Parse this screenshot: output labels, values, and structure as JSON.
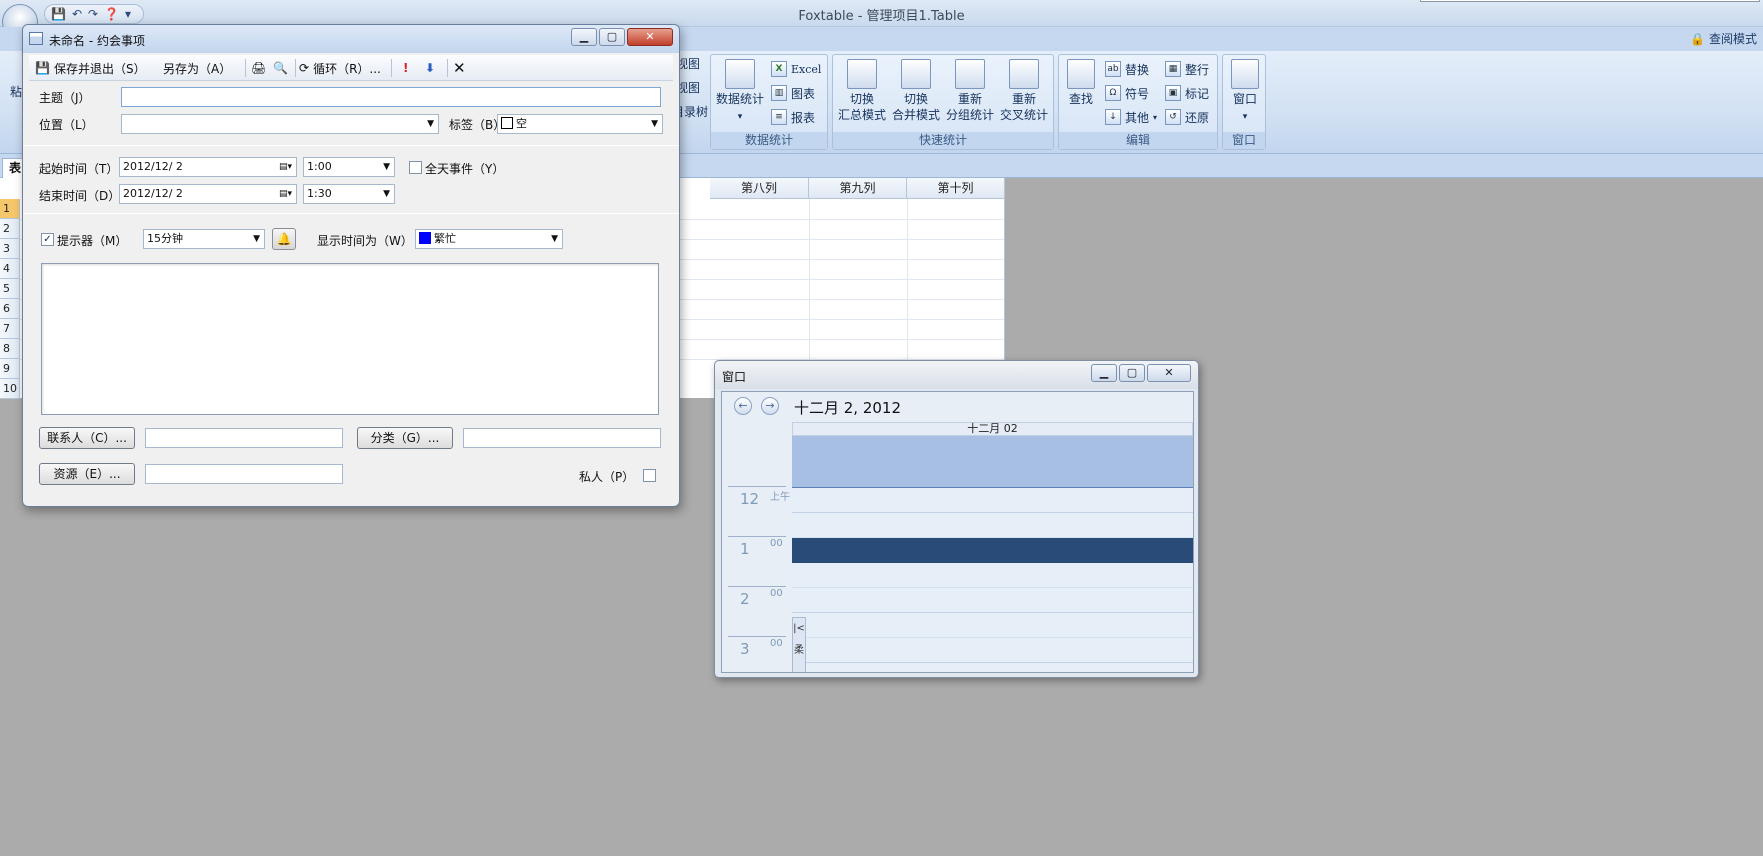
{
  "app": {
    "title": "Foxtable - 管理项目1.Table",
    "review_mode": "查阅模式"
  },
  "ribbon": {
    "clipped_labels": [
      "粘",
      "视图",
      "视图",
      "目录树"
    ],
    "groups": [
      {
        "caption": "数据统计",
        "big": [
          {
            "label": "数据统计",
            "icon": "table-stats-icon"
          }
        ],
        "small": [
          {
            "label": "Excel",
            "icon": "excel-icon"
          },
          {
            "label": "图表",
            "icon": "chart-icon"
          },
          {
            "label": "报表",
            "icon": "report-icon"
          }
        ]
      },
      {
        "caption": "快速统计",
        "big": [
          {
            "label1": "切换",
            "label2": "汇总模式",
            "icon": "summary-mode-icon"
          },
          {
            "label1": "切换",
            "label2": "合并模式",
            "icon": "merge-mode-icon"
          },
          {
            "label1": "重新",
            "label2": "分组统计",
            "icon": "group-stats-icon"
          },
          {
            "label1": "重新",
            "label2": "交叉统计",
            "icon": "cross-stats-icon"
          }
        ]
      },
      {
        "caption": "编辑",
        "big": [
          {
            "label": "查找",
            "icon": "binoculars-icon"
          }
        ],
        "small": [
          {
            "label": "替换",
            "icon": "replace-icon"
          },
          {
            "label": "符号",
            "icon": "omega-icon"
          },
          {
            "label": "其他",
            "icon": "other-icon"
          },
          {
            "label": "整行",
            "icon": "row-icon"
          },
          {
            "label": "标记",
            "icon": "mark-icon"
          },
          {
            "label": "还原",
            "icon": "restore-icon"
          }
        ]
      },
      {
        "caption": "窗口",
        "big": [
          {
            "label": "窗口",
            "icon": "window-icon"
          }
        ]
      }
    ]
  },
  "doc_tab": "表",
  "grid": {
    "columns": [
      "第八列",
      "第九列",
      "第十列"
    ],
    "rows": [
      "1",
      "2",
      "3",
      "4",
      "5",
      "6",
      "7",
      "8",
      "9",
      "10"
    ]
  },
  "appointment": {
    "title": "未命名 - 约会事项",
    "toolbar": {
      "save_exit": "保存并退出（S）",
      "save_as": "另存为（A）",
      "recurrence": "循环（R）..."
    },
    "subject_label": "主题（J）",
    "subject_value": "",
    "location_label": "位置（L）",
    "location_value": "",
    "tag_label": "标签（B）",
    "tag_value": "空",
    "start_label": "起始时间（T）",
    "start_date": "2012/12/ 2",
    "start_time": "1:00",
    "end_label": "结束时间（D）",
    "end_date": "2012/12/ 2",
    "end_time": "1:30",
    "allday_label": "全天事件（Y）",
    "allday_checked": false,
    "reminder_label": "提示器（M）",
    "reminder_checked": true,
    "reminder_value": "15分钟",
    "showas_label": "显示时间为（W）",
    "showas_value": "繁忙",
    "showas_color": "#0000ff",
    "notes": "",
    "contacts_button": "联系人（C）...",
    "contacts_value": "",
    "category_button": "分类（G）...",
    "category_value": "",
    "resources_button": "资源（E）...",
    "resources_value": "",
    "private_label": "私人（P）",
    "private_checked": false
  },
  "calendar": {
    "title": "窗口",
    "date_heading": "十二月 2, 2012",
    "day_header": "十二月 02",
    "hours": [
      {
        "hour": "12",
        "suffix": "上午"
      },
      {
        "hour": "1",
        "suffix": "00"
      },
      {
        "hour": "2",
        "suffix": "00"
      },
      {
        "hour": "3",
        "suffix": "00"
      }
    ],
    "busy_color": "#284b78",
    "collapse_glyph": "|<",
    "collapse_text": "柔"
  },
  "colors": {
    "ribbon_bg": "#cfdff2",
    "workspace_bg": "#ababab",
    "selected_row": "#f5c76a"
  }
}
